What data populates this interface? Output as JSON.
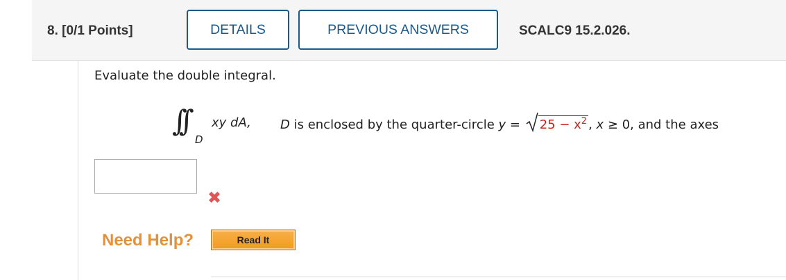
{
  "header": {
    "question_number": "8.",
    "points": "[0/1 Points]",
    "details_label": "DETAILS",
    "previous_answers_label": "PREVIOUS ANSWERS",
    "reference_code": "SCALC9 15.2.026."
  },
  "question": {
    "prompt": "Evaluate the double integral.",
    "integral_region_subscript": "D",
    "integrand": "xy dA,",
    "region_prefix": "D",
    "region_text": " is enclosed by the quarter-circle ",
    "y_var": "y",
    "equals": " = ",
    "sqrt_value": "25 − x",
    "exponent": "2",
    "conditions_var": "x",
    "conditions_rest": " ≥ 0, and the axes"
  },
  "answer": {
    "value": "",
    "status_icon": "incorrect-x-icon",
    "status_color": "#e05555"
  },
  "help": {
    "label": "Need Help?",
    "read_it_label": "Read It"
  },
  "colors": {
    "accent": "#1a5a8a",
    "help": "#e69138",
    "sqrt_value": "#c0261c"
  }
}
